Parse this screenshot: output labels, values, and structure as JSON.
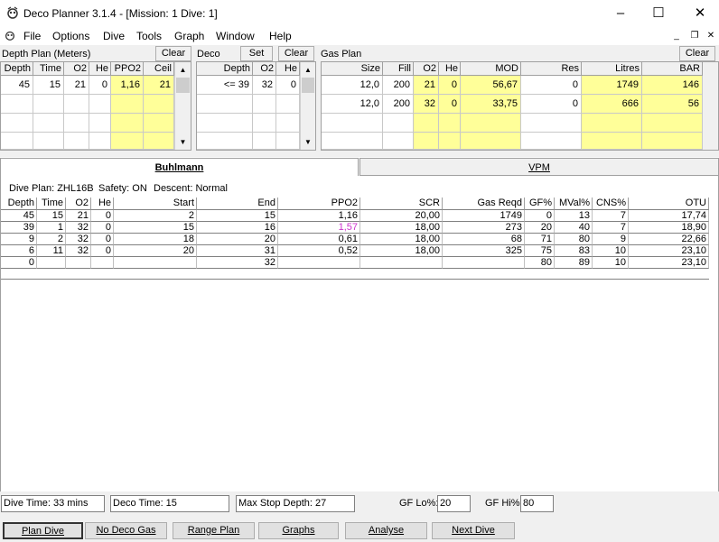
{
  "window": {
    "title": "Deco Planner 3.1.4 - [Mission: 1 Dive: 1]",
    "minimize": "–",
    "maximize": "☐",
    "close": "✕",
    "mdi_minimize": "_",
    "mdi_restore": "❐",
    "mdi_close": "✕"
  },
  "menu": [
    "File",
    "Options",
    "Dive",
    "Tools",
    "Graph",
    "Window",
    "Help"
  ],
  "depth_plan": {
    "label": "Depth Plan (Meters)",
    "clear": "Clear",
    "headers": [
      "Depth",
      "Time",
      "O2",
      "He",
      "PPO2",
      "Ceil"
    ],
    "rows": [
      [
        "45",
        "15",
        "21",
        "0",
        "1,16",
        "21"
      ]
    ]
  },
  "deco": {
    "label": "Deco",
    "set": "Set",
    "clear": "Clear",
    "headers": [
      "Depth",
      "O2",
      "He"
    ],
    "rows": [
      [
        "<= 39",
        "32",
        "0"
      ]
    ]
  },
  "gas_plan": {
    "label": "Gas Plan",
    "clear": "Clear",
    "headers": [
      "Size",
      "Fill",
      "O2",
      "He",
      "MOD",
      "Res",
      "Litres",
      "BAR"
    ],
    "rows": [
      [
        "12,0",
        "200",
        "21",
        "0",
        "56,67",
        "0",
        "1749",
        "146"
      ],
      [
        "12,0",
        "200",
        "32",
        "0",
        "33,75",
        "0",
        "666",
        "56"
      ]
    ]
  },
  "tabs": {
    "active": "Buhlmann",
    "other": "VPM"
  },
  "dive_plan_line": {
    "plan": "Dive Plan: ZHL16B",
    "safety": "Safety: ON",
    "descent": "Descent: Normal"
  },
  "results": {
    "headers": [
      "Depth",
      "Time",
      "O2",
      "He",
      "Start",
      "End",
      "PPO2",
      "SCR",
      "Gas Reqd",
      "GF%",
      "MVal%",
      "CNS%",
      "OTU"
    ],
    "rows": [
      [
        "45",
        "15",
        "21",
        "0",
        "2",
        "15",
        "1,16",
        "20,00",
        "1749",
        "0",
        "13",
        "7",
        "17,74"
      ],
      [
        "39",
        "1",
        "32",
        "0",
        "15",
        "16",
        "1,57",
        "18,00",
        "273",
        "20",
        "40",
        "7",
        "18,90"
      ],
      [
        "9",
        "2",
        "32",
        "0",
        "18",
        "20",
        "0,61",
        "18,00",
        "68",
        "71",
        "80",
        "9",
        "22,66"
      ],
      [
        "6",
        "11",
        "32",
        "0",
        "20",
        "31",
        "0,52",
        "18,00",
        "325",
        "75",
        "83",
        "10",
        "23,10"
      ],
      [
        "0",
        "",
        "",
        "",
        "",
        "32",
        "",
        "",
        "",
        "80",
        "89",
        "10",
        "23,10"
      ]
    ],
    "highlight_color": "#cc33cc"
  },
  "status": {
    "dive_time": "Dive Time: 33 mins",
    "deco_time": "Deco Time: 15",
    "max_stop": "Max Stop Depth: 27",
    "gf_lo_label": "GF Lo%:",
    "gf_lo": "20",
    "gf_hi_label": "GF Hi%:",
    "gf_hi": "80"
  },
  "buttons": [
    "Plan Dive",
    "No Deco Gas",
    "Range Plan",
    "Graphs",
    "Analyse",
    "Next Dive"
  ]
}
